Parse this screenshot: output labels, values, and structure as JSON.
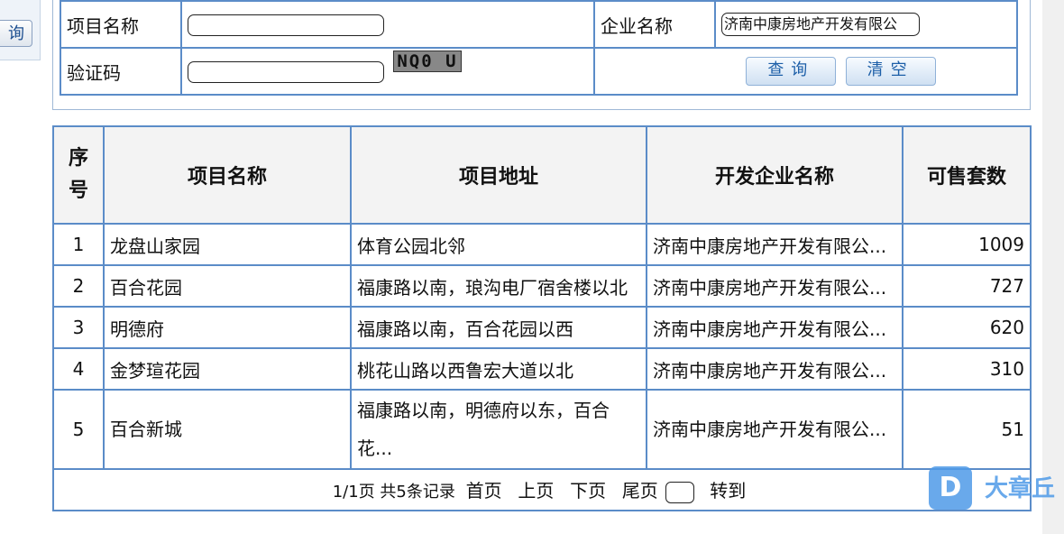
{
  "left_fragment": {
    "button_label": "询"
  },
  "search": {
    "project_name_label": "项目名称",
    "project_name_value": "",
    "company_name_label": "企业名称",
    "company_name_value": "济南中康房地产开发有限公",
    "captcha_label": "验证码",
    "captcha_value": "",
    "captcha_text": "NQ0 U",
    "query_button": "查询",
    "clear_button": "清空"
  },
  "table": {
    "headers": {
      "seq": "序号",
      "name": "项目名称",
      "address": "项目地址",
      "developer": "开发企业名称",
      "available": "可售套数"
    },
    "rows": [
      {
        "seq": "1",
        "name": "龙盘山家园",
        "address": "体育公园北邻",
        "developer": "济南中康房地产开发有限公...",
        "available": "1009"
      },
      {
        "seq": "2",
        "name": "百合花园",
        "address": "福康路以南，琅沟电厂宿舍楼以北",
        "developer": "济南中康房地产开发有限公...",
        "available": "727"
      },
      {
        "seq": "3",
        "name": "明德府",
        "address": "福康路以南，百合花园以西",
        "developer": "济南中康房地产开发有限公...",
        "available": "620"
      },
      {
        "seq": "4",
        "name": "金梦瑄花园",
        "address": "桃花山路以西鲁宏大道以北",
        "developer": "济南中康房地产开发有限公...",
        "available": "310"
      },
      {
        "seq": "5",
        "name": "百合新城",
        "address": "福康路以南，明德府以东，百合花...",
        "developer": "济南中康房地产开发有限公...",
        "available": "51"
      }
    ]
  },
  "pager": {
    "summary": "1/1页 共5条记录",
    "first": "首页",
    "prev": "上页",
    "next": "下页",
    "last": "尾页",
    "goto": "转到"
  },
  "watermark": {
    "icon_letter": "D",
    "text": "大章丘"
  },
  "colors": {
    "border": "#5b8cc8",
    "button_text": "#1d5fa8",
    "watermark": "#4f9be8"
  }
}
